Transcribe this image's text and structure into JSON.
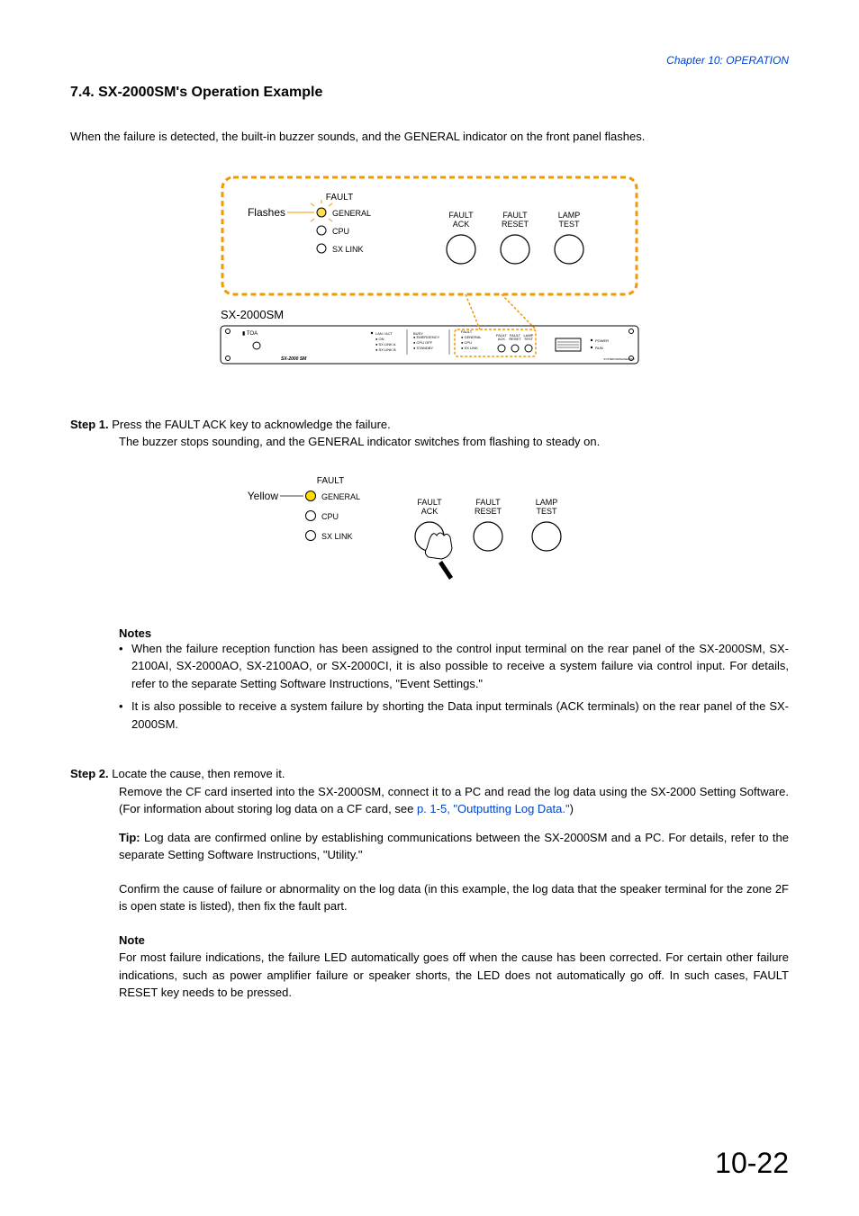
{
  "chapter": "Chapter 10: OPERATION",
  "section_title": "7.4. SX-2000SM's Operation Example",
  "intro": "When the failure is detected, the built-in buzzer sounds, and the GENERAL indicator on the front panel flashes.",
  "figure1": {
    "flashes": "Flashes",
    "fault": "FAULT",
    "general": "GENERAL",
    "cpu": "CPU",
    "sxlink": "SX LINK",
    "fault_ack": "FAULT\nACK",
    "fault_reset": "FAULT\nRESET",
    "lamp_test": "LAMP\nTEST",
    "device": "SX-2000SM",
    "toa": "TOA"
  },
  "step1": {
    "label": "Step 1.",
    "line1": "Press the FAULT ACK key to acknowledge the failure.",
    "line2": "The buzzer stops sounding, and the GENERAL indicator switches from flashing to steady on."
  },
  "figure2": {
    "yellow": "Yellow",
    "fault": "FAULT",
    "general": "GENERAL",
    "cpu": "CPU",
    "sxlink": "SX LINK",
    "fault_ack": "FAULT\nACK",
    "fault_reset": "FAULT\nRESET",
    "lamp_test": "LAMP\nTEST"
  },
  "notes1": {
    "heading": "Notes",
    "item1": "When the failure reception function has been assigned to the control input terminal on the rear panel of the SX-2000SM, SX-2100AI, SX-2000AO, SX-2100AO, or SX-2000CI, it is also possible to receive a system failure via control input. For details, refer to the separate Setting Software Instructions, \"Event Settings.\"",
    "item2": "It is also possible to receive a system failure by shorting the Data input terminals (ACK terminals) on the rear panel of the SX-2000SM."
  },
  "step2": {
    "label": "Step 2.",
    "line1": "Locate the cause, then remove it.",
    "line2a": "Remove the CF card inserted into the SX-2000SM, connect it to a PC and read the log data using the SX-2000 Setting Software. (For information about storing log data on a CF card, see ",
    "link": "p. 1-5, \"Outputting Log Data.\"",
    "line2b": ")",
    "tip_label": "Tip:",
    "tip_body": "Log data are confirmed online by establishing communications between the SX-2000SM and a PC. For details, refer to the separate Setting Software Instructions, \"Utility.\"",
    "confirm": "Confirm the cause of failure or abnormality on the log data (in this example, the log data that the speaker terminal for the zone 2F is open state is listed), then fix the fault part.",
    "note_heading": "Note",
    "note_body": "For most failure indications, the failure LED automatically goes off when the cause has been corrected. For certain other failure indications, such as power amplifier failure or speaker shorts, the LED does not automatically go off. In such cases, FAULT RESET key needs to be pressed."
  },
  "page_number": "10-22"
}
